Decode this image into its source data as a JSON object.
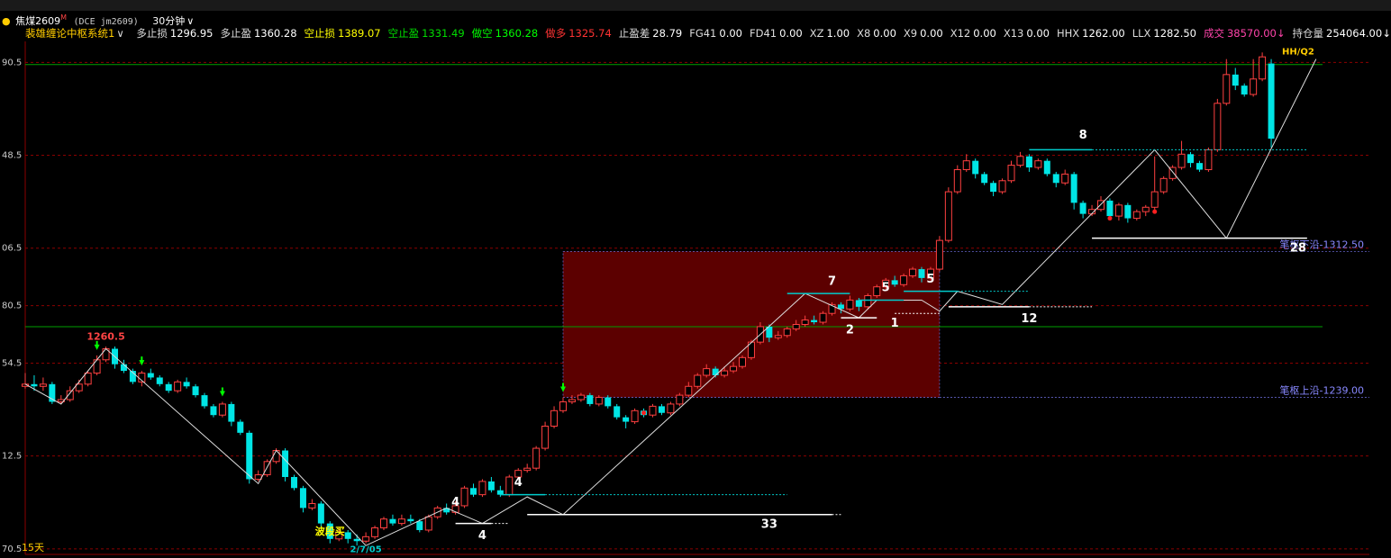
{
  "header": {
    "symbol_name": "焦煤2609",
    "symbol_mark": "M",
    "exchange_code": "(DCE  jm2609)",
    "timeframe": "30分钟",
    "system_name": "裴雄缠论中枢系统1",
    "dropdown_glyph": "∨"
  },
  "indicators": [
    {
      "label": "多止损",
      "value": "1296.95",
      "color": "#dddddd",
      "vcolor": "#ffffff"
    },
    {
      "label": "多止盈",
      "value": "1360.28",
      "color": "#dddddd",
      "vcolor": "#ffffff"
    },
    {
      "label": "空止损",
      "value": "1389.07",
      "color": "#ffff00",
      "vcolor": "#ffff00"
    },
    {
      "label": "空止盈",
      "value": "1331.49",
      "color": "#00dd00",
      "vcolor": "#00dd00"
    },
    {
      "label": "做空",
      "value": "1360.28",
      "color": "#00ff00",
      "vcolor": "#00ff00"
    },
    {
      "label": "做多",
      "value": "1325.74",
      "color": "#ff3333",
      "vcolor": "#ff3333"
    },
    {
      "label": "止盈差",
      "value": "28.79",
      "color": "#dddddd",
      "vcolor": "#ffffff"
    },
    {
      "label": "FG41",
      "value": "0.00",
      "color": "#dddddd",
      "vcolor": "#ffffff"
    },
    {
      "label": "FD41",
      "value": "0.00",
      "color": "#dddddd",
      "vcolor": "#ffffff"
    },
    {
      "label": "XZ",
      "value": "1.00",
      "color": "#dddddd",
      "vcolor": "#ffffff"
    },
    {
      "label": "X8",
      "value": "0.00",
      "color": "#dddddd",
      "vcolor": "#ffffff"
    },
    {
      "label": "X9",
      "value": "0.00",
      "color": "#dddddd",
      "vcolor": "#ffffff"
    },
    {
      "label": "X12",
      "value": "0.00",
      "color": "#dddddd",
      "vcolor": "#ffffff"
    },
    {
      "label": "X13",
      "value": "0.00",
      "color": "#dddddd",
      "vcolor": "#ffffff"
    },
    {
      "label": "HHX",
      "value": "1262.00",
      "color": "#dddddd",
      "vcolor": "#ffffff"
    },
    {
      "label": "LLX",
      "value": "1282.50",
      "color": "#dddddd",
      "vcolor": "#ffffff"
    },
    {
      "label": "成交",
      "value": "38570.00↓",
      "color": "#ff44aa",
      "vcolor": "#ff44aa"
    },
    {
      "label": "持仓量",
      "value": "254064.00↓",
      "color": "#dddddd",
      "vcolor": "#ffffff"
    }
  ],
  "footer": {
    "period_label": "15天"
  },
  "chart_data": {
    "type": "candlestick",
    "y_ticks": [
      "90.5",
      "48.5",
      "06.5",
      "80.5",
      "54.5",
      "12.5",
      "70.5"
    ],
    "y_tick_values": [
      1390.5,
      1348.5,
      1306.5,
      1280.5,
      1254.5,
      1212.5,
      1170.5
    ],
    "ylim": [
      1168,
      1400
    ],
    "zone": {
      "top": 1305,
      "bottom": 1239,
      "x_start": 60,
      "x_end": 102,
      "label_top": "笔枢下沿-1312.50",
      "label_bottom": "笔枢上沿-1239.00"
    },
    "green_hlines": [
      1389.5,
      1271
    ],
    "candles": [
      [
        1244,
        1245,
        1250,
        1243
      ],
      [
        1245,
        1244,
        1249,
        1242
      ],
      [
        1244,
        1245,
        1248,
        1242
      ],
      [
        1245,
        1237,
        1246,
        1236
      ],
      [
        1237,
        1238,
        1240,
        1236
      ],
      [
        1238,
        1242,
        1244,
        1237
      ],
      [
        1242,
        1245,
        1247,
        1241
      ],
      [
        1245,
        1250,
        1251,
        1244
      ],
      [
        1250,
        1256,
        1258,
        1249
      ],
      [
        1256,
        1261,
        1262,
        1255
      ],
      [
        1261,
        1254,
        1262,
        1252
      ],
      [
        1254,
        1251,
        1256,
        1250
      ],
      [
        1251,
        1246,
        1252,
        1245
      ],
      [
        1246,
        1250,
        1251,
        1244
      ],
      [
        1250,
        1248,
        1252,
        1247
      ],
      [
        1248,
        1245,
        1249,
        1244
      ],
      [
        1245,
        1242,
        1246,
        1241
      ],
      [
        1242,
        1246,
        1247,
        1241
      ],
      [
        1246,
        1244,
        1248,
        1243
      ],
      [
        1244,
        1240,
        1245,
        1239
      ],
      [
        1240,
        1235,
        1241,
        1234
      ],
      [
        1235,
        1231,
        1236,
        1230
      ],
      [
        1231,
        1236,
        1237,
        1230
      ],
      [
        1236,
        1228,
        1237,
        1226
      ],
      [
        1228,
        1223,
        1229,
        1222
      ],
      [
        1223,
        1202,
        1224,
        1200
      ],
      [
        1202,
        1204,
        1206,
        1201
      ],
      [
        1204,
        1210,
        1211,
        1203
      ],
      [
        1210,
        1215,
        1216,
        1209
      ],
      [
        1215,
        1203,
        1216,
        1201
      ],
      [
        1203,
        1198,
        1204,
        1197
      ],
      [
        1198,
        1189,
        1199,
        1187
      ],
      [
        1189,
        1191,
        1193,
        1188
      ],
      [
        1191,
        1182,
        1192,
        1180
      ],
      [
        1182,
        1175,
        1183,
        1173
      ],
      [
        1175,
        1178,
        1180,
        1174
      ],
      [
        1178,
        1175,
        1179,
        1173
      ],
      [
        1175,
        1174,
        1177,
        1172
      ],
      [
        1174,
        1176,
        1178,
        1173
      ],
      [
        1176,
        1180,
        1181,
        1175
      ],
      [
        1180,
        1184,
        1185,
        1179
      ],
      [
        1184,
        1182,
        1186,
        1181
      ],
      [
        1182,
        1184,
        1186,
        1181
      ],
      [
        1184,
        1183,
        1186,
        1182
      ],
      [
        1183,
        1179,
        1184,
        1178
      ],
      [
        1179,
        1185,
        1186,
        1178
      ],
      [
        1185,
        1189,
        1190,
        1184
      ],
      [
        1189,
        1187,
        1191,
        1186
      ],
      [
        1187,
        1190,
        1192,
        1186
      ],
      [
        1190,
        1198,
        1199,
        1189
      ],
      [
        1198,
        1195,
        1200,
        1194
      ],
      [
        1195,
        1201,
        1202,
        1194
      ],
      [
        1201,
        1197,
        1203,
        1196
      ],
      [
        1197,
        1195,
        1199,
        1194
      ],
      [
        1195,
        1203,
        1204,
        1194
      ],
      [
        1203,
        1206,
        1207,
        1202
      ],
      [
        1206,
        1207,
        1209,
        1205
      ],
      [
        1207,
        1216,
        1217,
        1206
      ],
      [
        1216,
        1226,
        1228,
        1215
      ],
      [
        1226,
        1233,
        1235,
        1225
      ],
      [
        1233,
        1237,
        1239,
        1232
      ],
      [
        1237,
        1238,
        1240,
        1236
      ],
      [
        1238,
        1240,
        1241,
        1237
      ],
      [
        1240,
        1236,
        1241,
        1235
      ],
      [
        1236,
        1239,
        1240,
        1235
      ],
      [
        1239,
        1235,
        1240,
        1234
      ],
      [
        1235,
        1230,
        1236,
        1229
      ],
      [
        1230,
        1228,
        1231,
        1225
      ],
      [
        1228,
        1233,
        1234,
        1227
      ],
      [
        1233,
        1231,
        1234,
        1230
      ],
      [
        1231,
        1235,
        1236,
        1230
      ],
      [
        1235,
        1232,
        1236,
        1231
      ],
      [
        1232,
        1236,
        1237,
        1231
      ],
      [
        1236,
        1240,
        1241,
        1235
      ],
      [
        1240,
        1244,
        1246,
        1239
      ],
      [
        1244,
        1249,
        1250,
        1243
      ],
      [
        1249,
        1252,
        1254,
        1248
      ],
      [
        1252,
        1249,
        1253,
        1248
      ],
      [
        1249,
        1251,
        1253,
        1248
      ],
      [
        1251,
        1253,
        1255,
        1250
      ],
      [
        1253,
        1257,
        1258,
        1252
      ],
      [
        1257,
        1264,
        1265,
        1256
      ],
      [
        1264,
        1271,
        1273,
        1263
      ],
      [
        1271,
        1266,
        1272,
        1264
      ],
      [
        1266,
        1267,
        1269,
        1265
      ],
      [
        1267,
        1270,
        1271,
        1266
      ],
      [
        1270,
        1272,
        1274,
        1269
      ],
      [
        1272,
        1274,
        1276,
        1271
      ],
      [
        1274,
        1273,
        1276,
        1272
      ],
      [
        1273,
        1277,
        1278,
        1272
      ],
      [
        1277,
        1281,
        1282,
        1276
      ],
      [
        1281,
        1279,
        1282,
        1277
      ],
      [
        1279,
        1283,
        1285,
        1278
      ],
      [
        1283,
        1280,
        1284,
        1278
      ],
      [
        1280,
        1285,
        1286,
        1279
      ],
      [
        1285,
        1289,
        1290,
        1284
      ],
      [
        1289,
        1292,
        1293,
        1288
      ],
      [
        1292,
        1290,
        1294,
        1289
      ],
      [
        1290,
        1294,
        1295,
        1289
      ],
      [
        1294,
        1297,
        1298,
        1293
      ],
      [
        1297,
        1293,
        1298,
        1291
      ],
      [
        1293,
        1297,
        1298,
        1292
      ],
      [
        1297,
        1310,
        1312,
        1296
      ],
      [
        1310,
        1332,
        1334,
        1309
      ],
      [
        1332,
        1342,
        1344,
        1331
      ],
      [
        1342,
        1346,
        1349,
        1341
      ],
      [
        1346,
        1340,
        1347,
        1338
      ],
      [
        1340,
        1336,
        1341,
        1335
      ],
      [
        1336,
        1332,
        1337,
        1330
      ],
      [
        1332,
        1337,
        1338,
        1331
      ],
      [
        1337,
        1344,
        1346,
        1336
      ],
      [
        1344,
        1348,
        1350,
        1343
      ],
      [
        1348,
        1343,
        1349,
        1341
      ],
      [
        1343,
        1346,
        1347,
        1342
      ],
      [
        1346,
        1340,
        1347,
        1339
      ],
      [
        1340,
        1336,
        1341,
        1334
      ],
      [
        1336,
        1340,
        1342,
        1335
      ],
      [
        1340,
        1327,
        1341,
        1324
      ],
      [
        1327,
        1322,
        1328,
        1320
      ],
      [
        1322,
        1324,
        1326,
        1321
      ],
      [
        1324,
        1328,
        1330,
        1323
      ],
      [
        1328,
        1321,
        1329,
        1320
      ],
      [
        1321,
        1326,
        1327,
        1319
      ],
      [
        1326,
        1320,
        1327,
        1318
      ],
      [
        1320,
        1323,
        1324,
        1319
      ],
      [
        1323,
        1325,
        1326,
        1321
      ],
      [
        1325,
        1332,
        1348,
        1324
      ],
      [
        1332,
        1338,
        1339,
        1331
      ],
      [
        1338,
        1343,
        1344,
        1337
      ],
      [
        1343,
        1349,
        1355,
        1342
      ],
      [
        1349,
        1345,
        1350,
        1343
      ],
      [
        1345,
        1342,
        1346,
        1341
      ],
      [
        1342,
        1351,
        1352,
        1341
      ],
      [
        1351,
        1372,
        1374,
        1350
      ],
      [
        1372,
        1385,
        1392,
        1371
      ],
      [
        1385,
        1380,
        1388,
        1378
      ],
      [
        1380,
        1376,
        1381,
        1375
      ],
      [
        1376,
        1383,
        1392,
        1375
      ],
      [
        1383,
        1393,
        1395,
        1382
      ],
      [
        1390,
        1356,
        1392,
        1352
      ]
    ],
    "candle_x_first": 28,
    "candle_x_step": 9.95,
    "bi_polyline": [
      [
        0,
        1245
      ],
      [
        4,
        1236
      ],
      [
        9,
        1261
      ],
      [
        26,
        1200
      ],
      [
        28,
        1215
      ],
      [
        38,
        1172
      ],
      [
        47,
        1189
      ],
      [
        51,
        1182
      ],
      [
        56,
        1194
      ],
      [
        60,
        1186
      ],
      [
        87,
        1286
      ],
      [
        93,
        1275
      ],
      [
        95,
        1283
      ],
      [
        100,
        1283
      ],
      [
        102,
        1278
      ],
      [
        104,
        1287
      ],
      [
        109,
        1281
      ],
      [
        126,
        1351
      ],
      [
        134,
        1311
      ],
      [
        144,
        1392
      ]
    ],
    "segments": [
      {
        "y": 1195,
        "x1": 53,
        "x2": 58,
        "color": "#00cccc"
      },
      {
        "y": 1195,
        "x1": 58,
        "x2": 85,
        "color": "#00cccc",
        "dash": true
      },
      {
        "y": 1186,
        "x1": 56,
        "x2": 90,
        "color": "#ffffff"
      },
      {
        "y": 1186,
        "x1": 90,
        "x2": 91,
        "color": "#ffffff",
        "dash": true
      },
      {
        "y": 1182,
        "x1": 48,
        "x2": 52,
        "color": "#ffffff"
      },
      {
        "y": 1182,
        "x1": 52,
        "x2": 54,
        "color": "#ffffff",
        "dash": true
      },
      {
        "y": 1286,
        "x1": 85,
        "x2": 92,
        "color": "#00cccc"
      },
      {
        "y": 1275,
        "x1": 91,
        "x2": 95,
        "color": "#ffffff"
      },
      {
        "y": 1283,
        "x1": 93,
        "x2": 98,
        "color": "#00cccc"
      },
      {
        "y": 1277,
        "x1": 97,
        "x2": 102,
        "color": "#ffffff",
        "dash": true
      },
      {
        "y": 1287,
        "x1": 98,
        "x2": 104,
        "color": "#00cccc"
      },
      {
        "y": 1287,
        "x1": 104,
        "x2": 112,
        "color": "#00cccc",
        "dash": true
      },
      {
        "y": 1280,
        "x1": 103,
        "x2": 112,
        "color": "#ffffff"
      },
      {
        "y": 1280,
        "x1": 112,
        "x2": 119,
        "color": "#ffffff",
        "dash": true
      },
      {
        "y": 1351,
        "x1": 112,
        "x2": 119,
        "color": "#00cccc"
      },
      {
        "y": 1351,
        "x1": 119,
        "x2": 143,
        "color": "#00cccc",
        "dash": true
      },
      {
        "y": 1311,
        "x1": 119,
        "x2": 143,
        "color": "#ffffff"
      }
    ],
    "labels": [
      {
        "text": "1260.5",
        "i": 9,
        "y": 1265,
        "color": "#ff4444",
        "size": 11
      },
      {
        "text": "4",
        "i": 55,
        "y": 1199,
        "color": "#ffffff",
        "size": 13
      },
      {
        "text": "4",
        "i": 48,
        "y": 1190,
        "color": "#ffffff",
        "size": 13
      },
      {
        "text": "4",
        "i": 51,
        "y": 1175,
        "color": "#ffffff",
        "size": 13
      },
      {
        "text": "33",
        "i": 83,
        "y": 1180,
        "color": "#ffffff",
        "size": 13
      },
      {
        "text": "7",
        "i": 90,
        "y": 1290,
        "color": "#ffffff",
        "size": 13
      },
      {
        "text": "2",
        "i": 92,
        "y": 1268,
        "color": "#ffffff",
        "size": 13
      },
      {
        "text": "5",
        "i": 96,
        "y": 1287,
        "color": "#ffffff",
        "size": 13
      },
      {
        "text": "1",
        "i": 97,
        "y": 1271,
        "color": "#ffffff",
        "size": 13
      },
      {
        "text": "5",
        "i": 101,
        "y": 1291,
        "color": "#ffffff",
        "size": 13
      },
      {
        "text": "12",
        "i": 112,
        "y": 1273,
        "color": "#ffffff",
        "size": 13
      },
      {
        "text": "8",
        "i": 118,
        "y": 1356,
        "color": "#ffffff",
        "size": 13
      },
      {
        "text": "28",
        "i": 142,
        "y": 1305,
        "color": "#ffffff",
        "size": 13
      },
      {
        "text": "波段买",
        "i": 34,
        "y": 1177,
        "color": "#ffff00",
        "size": 11
      },
      {
        "text": "2/7/05",
        "i": 38,
        "y": 1169,
        "color": "#00cccc",
        "size": 10
      },
      {
        "text": "HH/Q2",
        "i": 142,
        "y": 1394,
        "color": "#ffcc00",
        "size": 10
      }
    ],
    "down_arrows": [
      8,
      13,
      22,
      60
    ],
    "red_dots": [
      [
        69,
        1232
      ],
      [
        121,
        1320
      ],
      [
        126,
        1323
      ]
    ]
  }
}
